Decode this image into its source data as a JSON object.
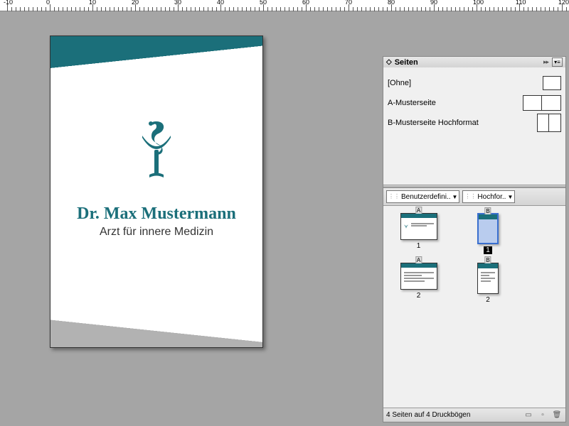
{
  "ruler": {
    "majors": [
      -10,
      0,
      10,
      20,
      30,
      40,
      50,
      60,
      70,
      80,
      90,
      100,
      110,
      120
    ]
  },
  "document": {
    "title": "Dr. Max Mustermann",
    "subtitle": "Arzt für innere Medizin",
    "accent_color": "#1b6f7a",
    "icon": "bowl-of-hygieia-icon"
  },
  "panel": {
    "title": "Seiten",
    "masters": [
      {
        "name": "[Ohne]",
        "kind": "single"
      },
      {
        "name": "A-Musterseite",
        "kind": "spread"
      },
      {
        "name": "B-Musterseite Hochformat",
        "kind": "portrait-spread"
      }
    ],
    "dropdowns": [
      "Benutzerdefini..",
      "Hochfor.."
    ],
    "pages": [
      {
        "master": "A",
        "orient": "landscape",
        "label": "1",
        "selected": false,
        "variant": "plain"
      },
      {
        "master": "B",
        "orient": "portrait",
        "label": "1",
        "selected": true,
        "variant": "plain"
      },
      {
        "master": "A",
        "orient": "landscape",
        "label": "2",
        "selected": false,
        "variant": "content"
      },
      {
        "master": "B",
        "orient": "portrait",
        "label": "2",
        "selected": false,
        "variant": "content"
      }
    ],
    "status": "4 Seiten auf 4 Druckbögen"
  }
}
